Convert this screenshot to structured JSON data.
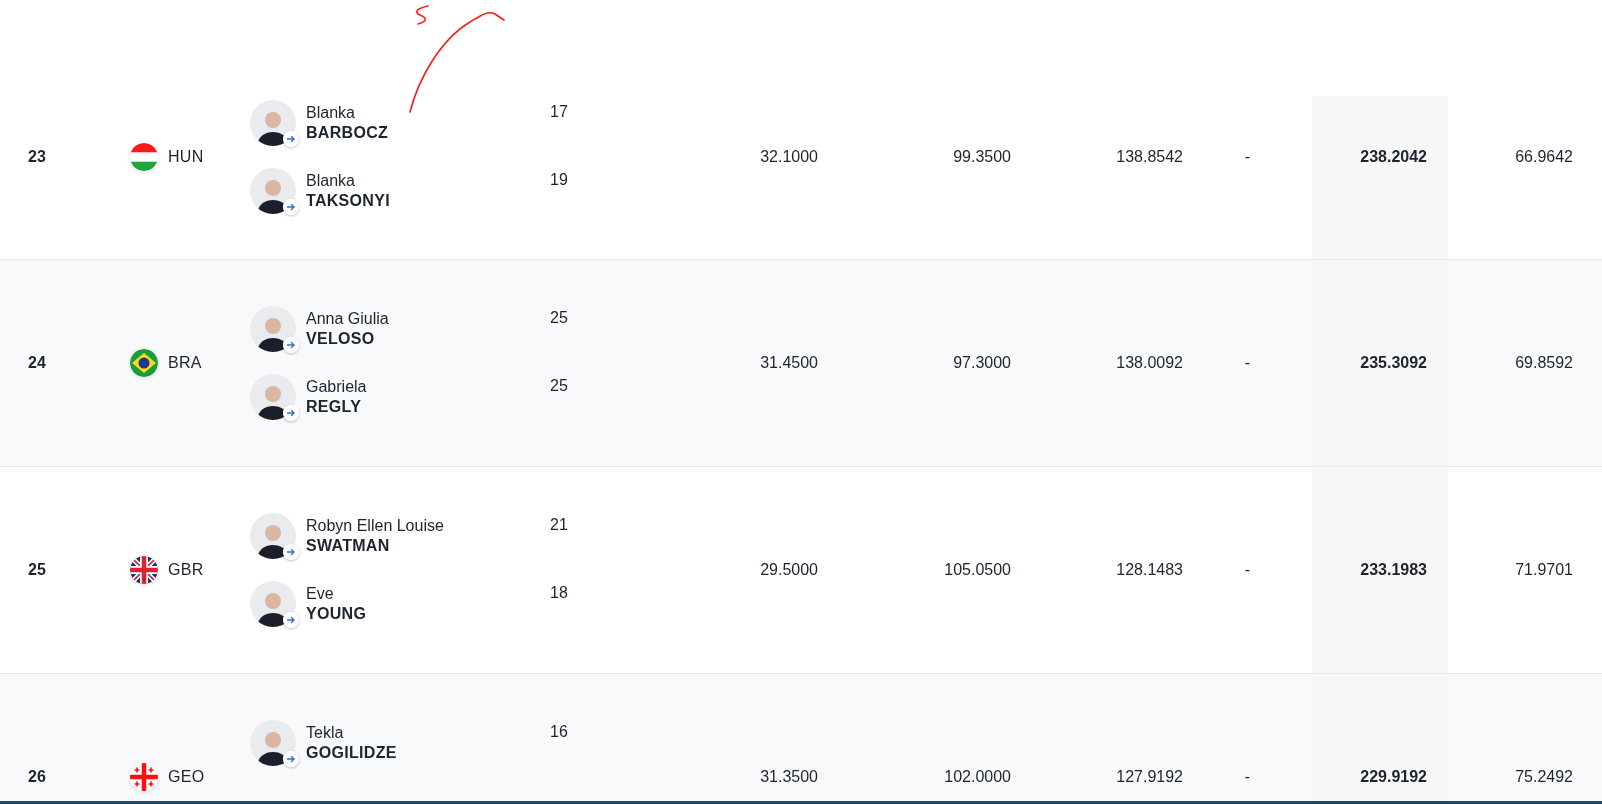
{
  "table": {
    "columns": [
      {
        "highlighted": false
      },
      {
        "highlighted": false
      },
      {
        "highlighted": false
      },
      {
        "highlighted": false
      },
      {
        "highlighted": true
      },
      {
        "highlighted": false
      }
    ],
    "rows": [
      {
        "rank": "23",
        "country": {
          "code": "HUN",
          "kind": "hungary"
        },
        "athletes": [
          {
            "first_name": "Blanka",
            "last_name": "BARBOCZ",
            "age": "17"
          },
          {
            "first_name": "Blanka",
            "last_name": "TAKSONYI",
            "age": "19"
          }
        ],
        "cells": [
          "32.1000",
          "99.3500",
          "138.8542",
          "-",
          "238.2042",
          "66.9642"
        ]
      },
      {
        "rank": "24",
        "country": {
          "code": "BRA",
          "kind": "brazil"
        },
        "athletes": [
          {
            "first_name": "Anna Giulia",
            "last_name": "VELOSO",
            "age": "25"
          },
          {
            "first_name": "Gabriela",
            "last_name": "REGLY",
            "age": "25"
          }
        ],
        "cells": [
          "31.4500",
          "97.3000",
          "138.0092",
          "-",
          "235.3092",
          "69.8592"
        ]
      },
      {
        "rank": "25",
        "country": {
          "code": "GBR",
          "kind": "uk"
        },
        "athletes": [
          {
            "first_name": "Robyn Ellen Louise",
            "last_name": "SWATMAN",
            "age": "21"
          },
          {
            "first_name": "Eve",
            "last_name": "YOUNG",
            "age": "18"
          }
        ],
        "cells": [
          "29.5000",
          "105.0500",
          "128.1483",
          "-",
          "233.1983",
          "71.9701"
        ]
      },
      {
        "rank": "26",
        "country": {
          "code": "GEO",
          "kind": "georgia"
        },
        "athletes": [
          {
            "first_name": "Tekla",
            "last_name": "GOGILIDZE",
            "age": "16"
          }
        ],
        "cells": [
          "31.3500",
          "102.0000",
          "127.9192",
          "-",
          "229.9192",
          "75.2492"
        ]
      }
    ]
  }
}
